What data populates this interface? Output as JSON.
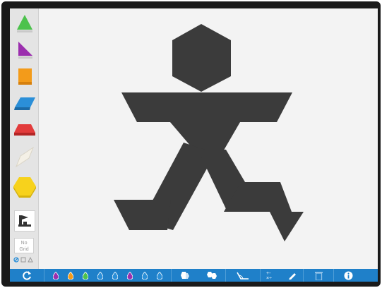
{
  "sidebar": {
    "tools": [
      {
        "name": "triangle-tool",
        "color": "#4cc24c"
      },
      {
        "name": "right-triangle-tool",
        "color": "#9b2fae"
      },
      {
        "name": "square-tool",
        "color": "#f39b1a"
      },
      {
        "name": "rhombus-tool",
        "color": "#2b8fd8"
      },
      {
        "name": "trapezoid-tool",
        "color": "#e23b3b"
      },
      {
        "name": "thin-rhombus-tool",
        "color": "#f4f0e6"
      },
      {
        "name": "hexagon-tool",
        "color": "#f7d21c"
      },
      {
        "name": "stamp-tool",
        "color": "#333333"
      }
    ],
    "grid": {
      "line1": "No",
      "line2": "Grid"
    }
  },
  "canvas": {
    "figure_color": "#3b3b3b",
    "background": "#f3f3f3"
  },
  "bottombar": {
    "color": "#1f80c9",
    "drop_colors": [
      "#9b2fae",
      "#f39b1a",
      "#4cc24c",
      "#2b8fd8",
      "#2b8fd8",
      "#9b2fae",
      "#2b8fd8",
      "#2b8fd8"
    ]
  }
}
